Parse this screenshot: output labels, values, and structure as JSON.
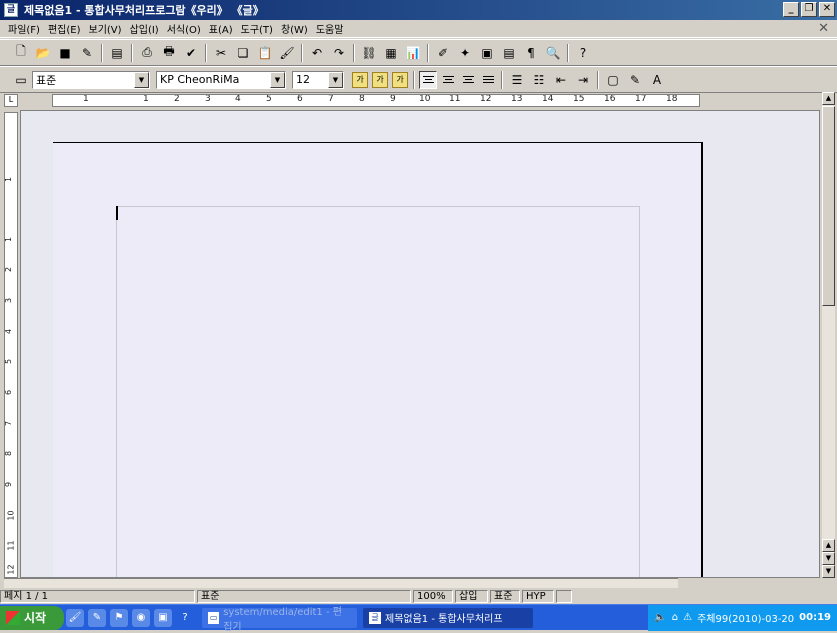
{
  "window": {
    "title": "제목없음1 - 통합사무처리프로그람《우리》 《글》",
    "icon": "document-icon"
  },
  "menu": [
    "파일(F)",
    "편집(E)",
    "보기(V)",
    "삽입(I)",
    "서식(O)",
    "표(A)",
    "도구(T)",
    "창(W)",
    "도움말"
  ],
  "format": {
    "style": "표준",
    "font": "KP CheonRiMa",
    "size": "12",
    "bold": "가",
    "italic": "가",
    "underline": "가"
  },
  "ruler": {
    "h_marks": [
      "1",
      "1",
      "2",
      "3",
      "4",
      "5",
      "6",
      "7",
      "8",
      "9",
      "10",
      "11",
      "12",
      "13",
      "14",
      "15",
      "16",
      "17",
      "18"
    ],
    "v_marks": [
      "1",
      "1",
      "2",
      "3",
      "4",
      "5",
      "6",
      "7",
      "8",
      "9",
      "10",
      "11",
      "12"
    ]
  },
  "status": {
    "page": "페지 1 / 1",
    "style": "표준",
    "zoom": "100%",
    "mode": "삽입",
    "std": "표준",
    "hyp": "HYP"
  },
  "taskbar": {
    "start": "시작",
    "task_inactive": "system/media/edit1 - 편집기",
    "task_active": "제목없음1 - 통합사무처리프",
    "tray_date": "주체99(2010)-03-20",
    "tray_time": "00:19"
  }
}
